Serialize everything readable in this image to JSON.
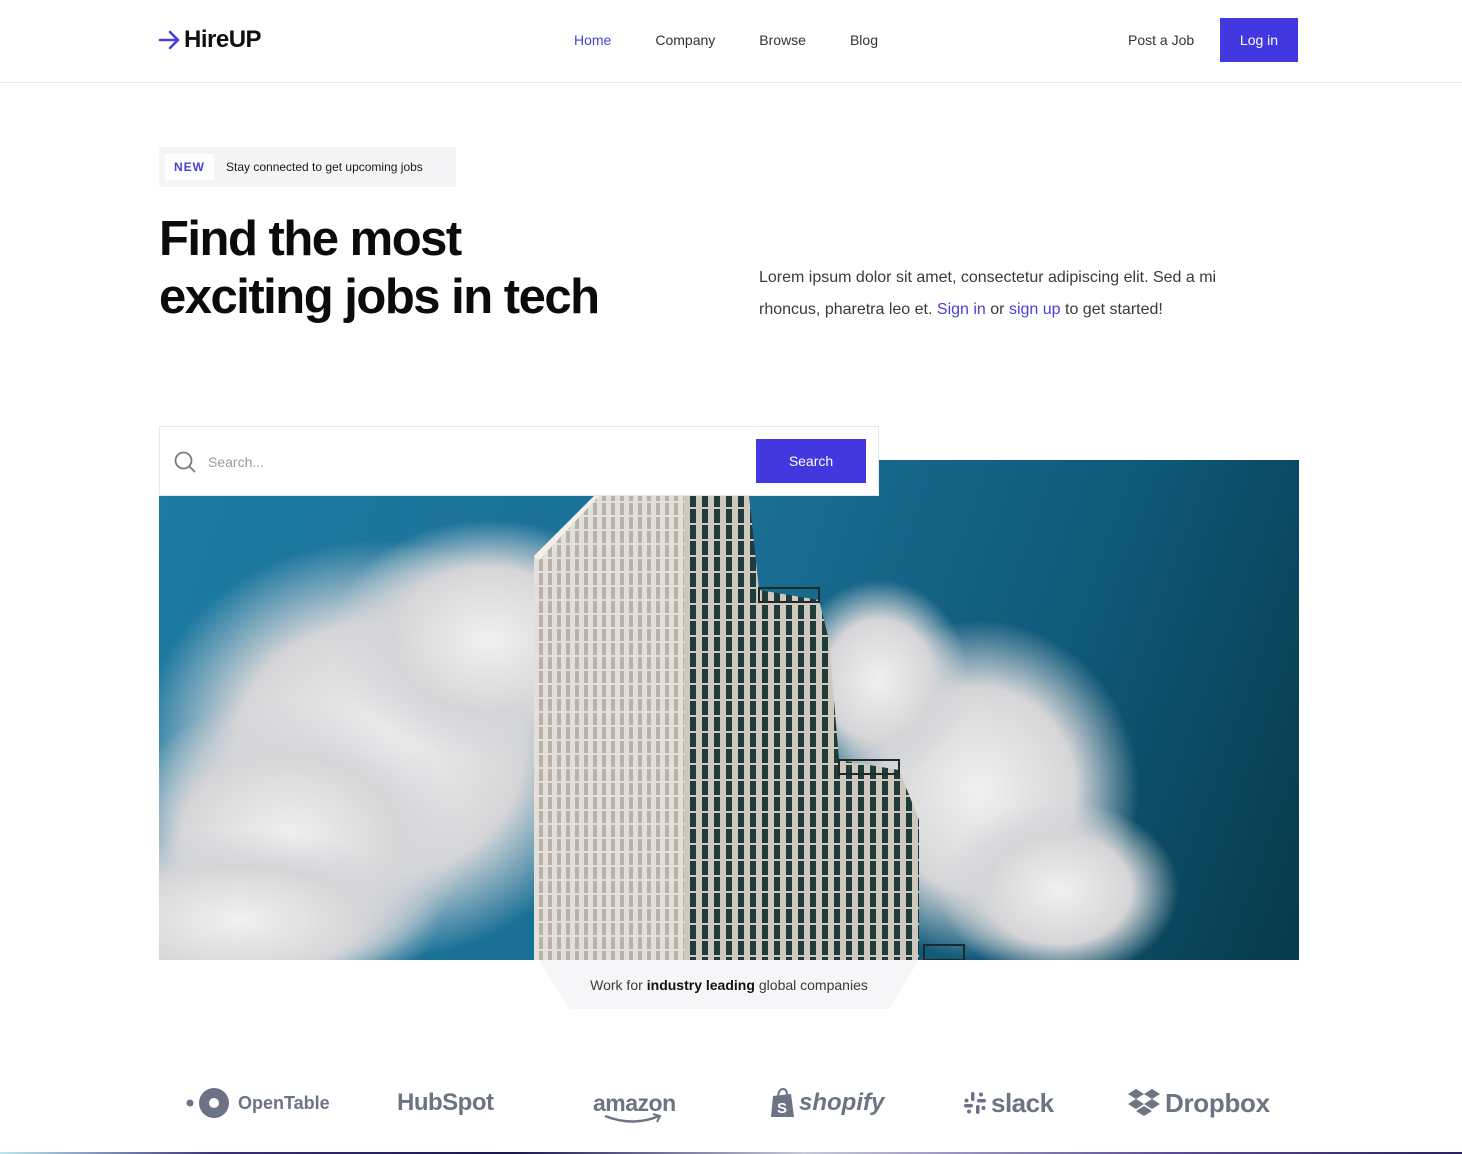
{
  "header": {
    "brand": "HireUP",
    "nav": [
      {
        "label": "Home",
        "active": true
      },
      {
        "label": "Company",
        "active": false
      },
      {
        "label": "Browse",
        "active": false
      },
      {
        "label": "Blog",
        "active": false
      }
    ],
    "post_job_label": "Post a Job",
    "login_label": "Log in"
  },
  "hero": {
    "badge_tag": "NEW",
    "badge_text": "Stay connected to get upcoming jobs",
    "title_line1": "Find the most",
    "title_line2": "exciting jobs in tech",
    "description": "Lorem ipsum dolor sit amet, consectetur adipiscing elit. Sed a mi rhoncus, pharetra leo et.",
    "sign_in_label": "Sign in",
    "or_text": "or",
    "sign_up_label": "sign up",
    "suffix_text": "to get started!"
  },
  "search": {
    "placeholder": "Search...",
    "value": "",
    "button_label": "Search"
  },
  "caption": {
    "prefix": "Work for",
    "bold": "industry leading",
    "suffix": "global companies"
  },
  "companies": [
    {
      "name": "OpenTable",
      "icon": "opentable-logo"
    },
    {
      "name": "HubSpot",
      "icon": "hubspot-logo"
    },
    {
      "name": "amazon",
      "icon": "amazon-logo"
    },
    {
      "name": "shopify",
      "icon": "shopify-logo"
    },
    {
      "name": "slack",
      "icon": "slack-logo"
    },
    {
      "name": "Dropbox",
      "icon": "dropbox-logo"
    }
  ],
  "colors": {
    "accent": "#4338e0",
    "link": "#4a3fd6",
    "logo_gray": "#6b7385"
  }
}
